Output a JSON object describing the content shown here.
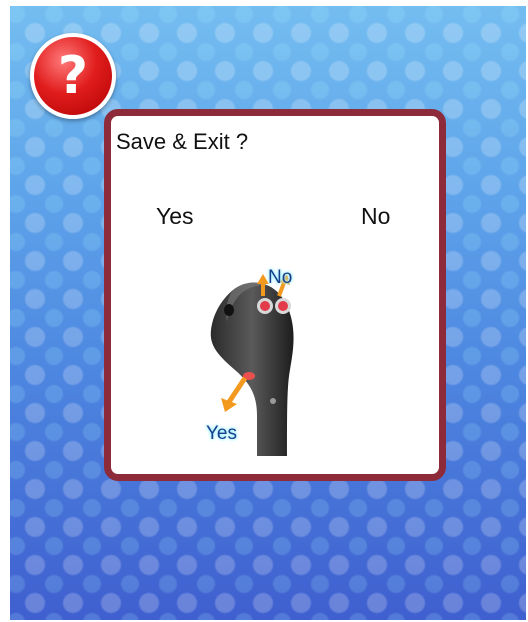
{
  "icons": {
    "help": "question-mark-icon",
    "help_glyph": "?"
  },
  "dialog": {
    "title": "Save & Exit ?",
    "options": {
      "yes": "Yes",
      "no": "No"
    },
    "joystick_hint": {
      "image": "joystick-icon",
      "up_label": "No",
      "down_label": "Yes"
    }
  },
  "colors": {
    "dialog_border": "#8e2b3a",
    "help_icon": "#e11d1d",
    "hint_text": "#1a3e8c",
    "arrow": "#f39a1e"
  }
}
